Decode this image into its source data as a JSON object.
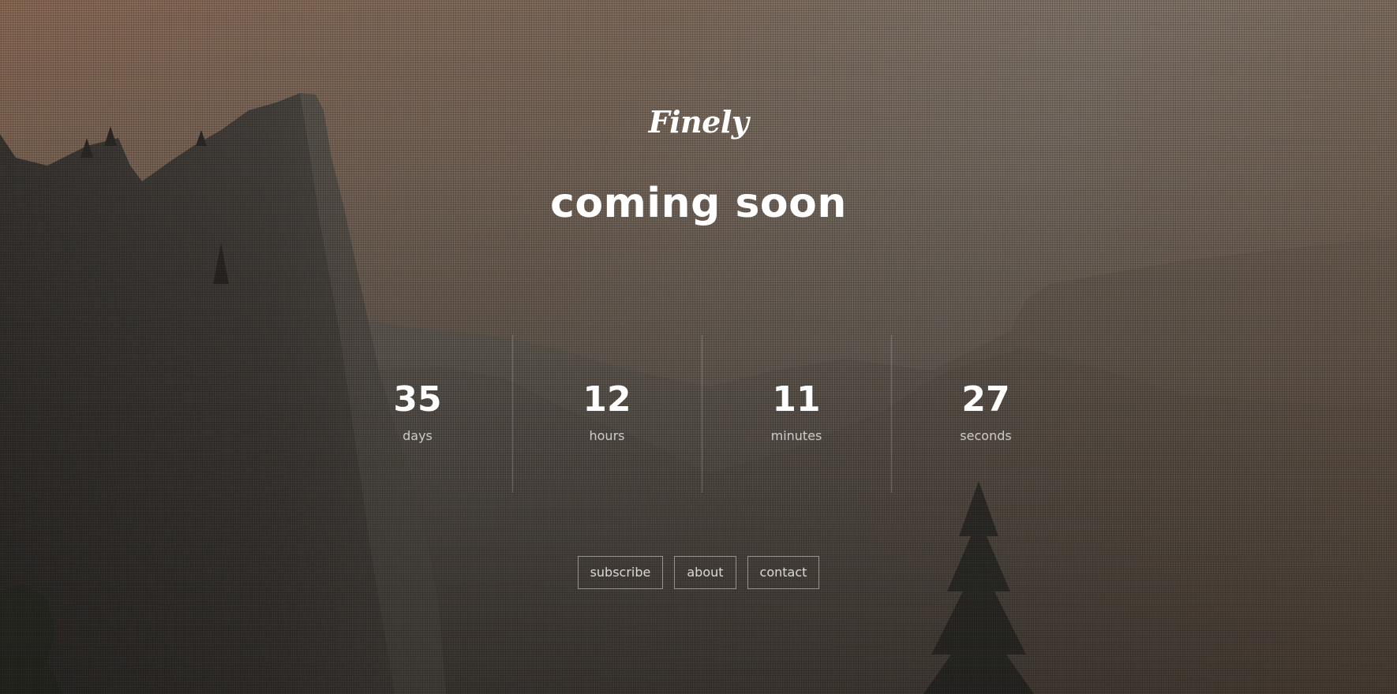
{
  "brand": {
    "logo_text": "Finely"
  },
  "hero": {
    "headline": "coming soon"
  },
  "countdown": {
    "units": [
      {
        "value": "35",
        "label": "days"
      },
      {
        "value": "12",
        "label": "hours"
      },
      {
        "value": "11",
        "label": "minutes"
      },
      {
        "value": "27",
        "label": "seconds"
      }
    ]
  },
  "nav": {
    "links": [
      {
        "label": "subscribe"
      },
      {
        "label": "about"
      },
      {
        "label": "contact"
      }
    ]
  },
  "colors": {
    "text": "#ffffff",
    "sky_warm": "#8a6b57",
    "sky_haze": "#8f8c86",
    "cliff": "#3a3632"
  }
}
